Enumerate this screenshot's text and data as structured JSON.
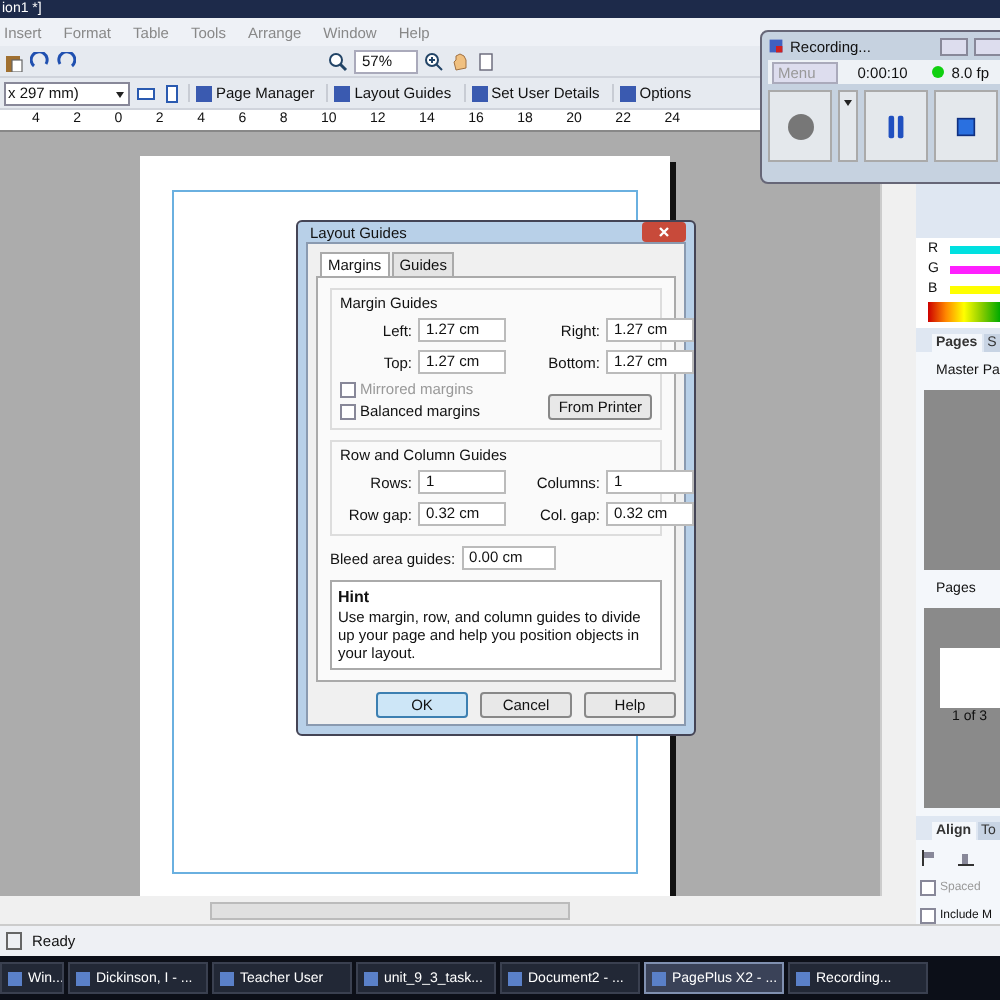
{
  "window": {
    "title": "ion1 *]"
  },
  "menu": [
    "Insert",
    "Format",
    "Table",
    "Tools",
    "Arrange",
    "Window",
    "Help"
  ],
  "toolbar": {
    "zoom": "57%"
  },
  "context_bar": {
    "page_size": "x 297 mm)",
    "buttons": [
      "Page Manager",
      "Layout Guides",
      "Set User Details",
      "Options"
    ]
  },
  "ruler": [
    "4",
    "2",
    "0",
    "2",
    "4",
    "6",
    "8",
    "10",
    "12",
    "14",
    "16",
    "18",
    "20",
    "22",
    "24"
  ],
  "dialog": {
    "title": "Layout Guides",
    "tabs": [
      {
        "label": "Margins",
        "selected": true
      },
      {
        "label": "Guides",
        "selected": false
      }
    ],
    "margin_group": {
      "title": "Margin Guides",
      "fields": [
        {
          "label": "Left:",
          "value": "1.27 cm"
        },
        {
          "label": "Right:",
          "value": "1.27 cm"
        },
        {
          "label": "Top:",
          "value": "1.27 cm"
        },
        {
          "label": "Bottom:",
          "value": "1.27 cm"
        }
      ],
      "checkboxes": [
        {
          "label": "Mirrored margins",
          "checked": false,
          "disabled": true
        },
        {
          "label": "Balanced margins",
          "checked": false,
          "disabled": false
        }
      ],
      "button": "From Printer"
    },
    "grid_group": {
      "title": "Row and Column Guides",
      "fields": [
        {
          "label": "Rows:",
          "value": "1"
        },
        {
          "label": "Columns:",
          "value": "1"
        },
        {
          "label": "Row gap:",
          "value": "0.32 cm"
        },
        {
          "label": "Col. gap:",
          "value": "0.32 cm"
        }
      ]
    },
    "bleed": {
      "label": "Bleed area guides:",
      "value": "0.00 cm"
    },
    "hint": {
      "title": "Hint",
      "text": "Use margin, row, and column guides to divide up your page and help you position objects in your layout."
    },
    "buttons": [
      {
        "label": "OK",
        "default": true
      },
      {
        "label": "Cancel",
        "default": false
      },
      {
        "label": "Help",
        "default": false
      }
    ]
  },
  "recorder": {
    "title": "Recording...",
    "menu": "Menu",
    "time": "0:00:10",
    "fps": "8.0 fp"
  },
  "color_panel": {
    "channels": [
      {
        "label": "R",
        "color": "#00e0e0"
      },
      {
        "label": "G",
        "color": "#ff20ff"
      },
      {
        "label": "B",
        "color": "#ffff00"
      }
    ]
  },
  "pages_panel": {
    "tabs": [
      {
        "label": "Pages",
        "selected": true
      },
      {
        "label": "S",
        "selected": false
      }
    ],
    "master_label": "Master Pa",
    "pages_label": "Pages",
    "page_caption": "1 of 3"
  },
  "align_panel": {
    "tabs": [
      {
        "label": "Align",
        "selected": true
      },
      {
        "label": "To",
        "selected": false
      }
    ],
    "options": [
      {
        "label": "Spaced",
        "checked": false,
        "disabled": true
      },
      {
        "label": "Include M",
        "checked": false,
        "disabled": false
      }
    ]
  },
  "status_bar": "Ready",
  "taskbar": [
    {
      "label": "Win...",
      "selected": false
    },
    {
      "label": "Dickinson, I - ...",
      "selected": false
    },
    {
      "label": "Teacher User",
      "selected": false
    },
    {
      "label": "unit_9_3_task...",
      "selected": false
    },
    {
      "label": "Document2 - ...",
      "selected": false
    },
    {
      "label": "PagePlus X2 - ...",
      "selected": true
    },
    {
      "label": "Recording...",
      "selected": false
    }
  ]
}
